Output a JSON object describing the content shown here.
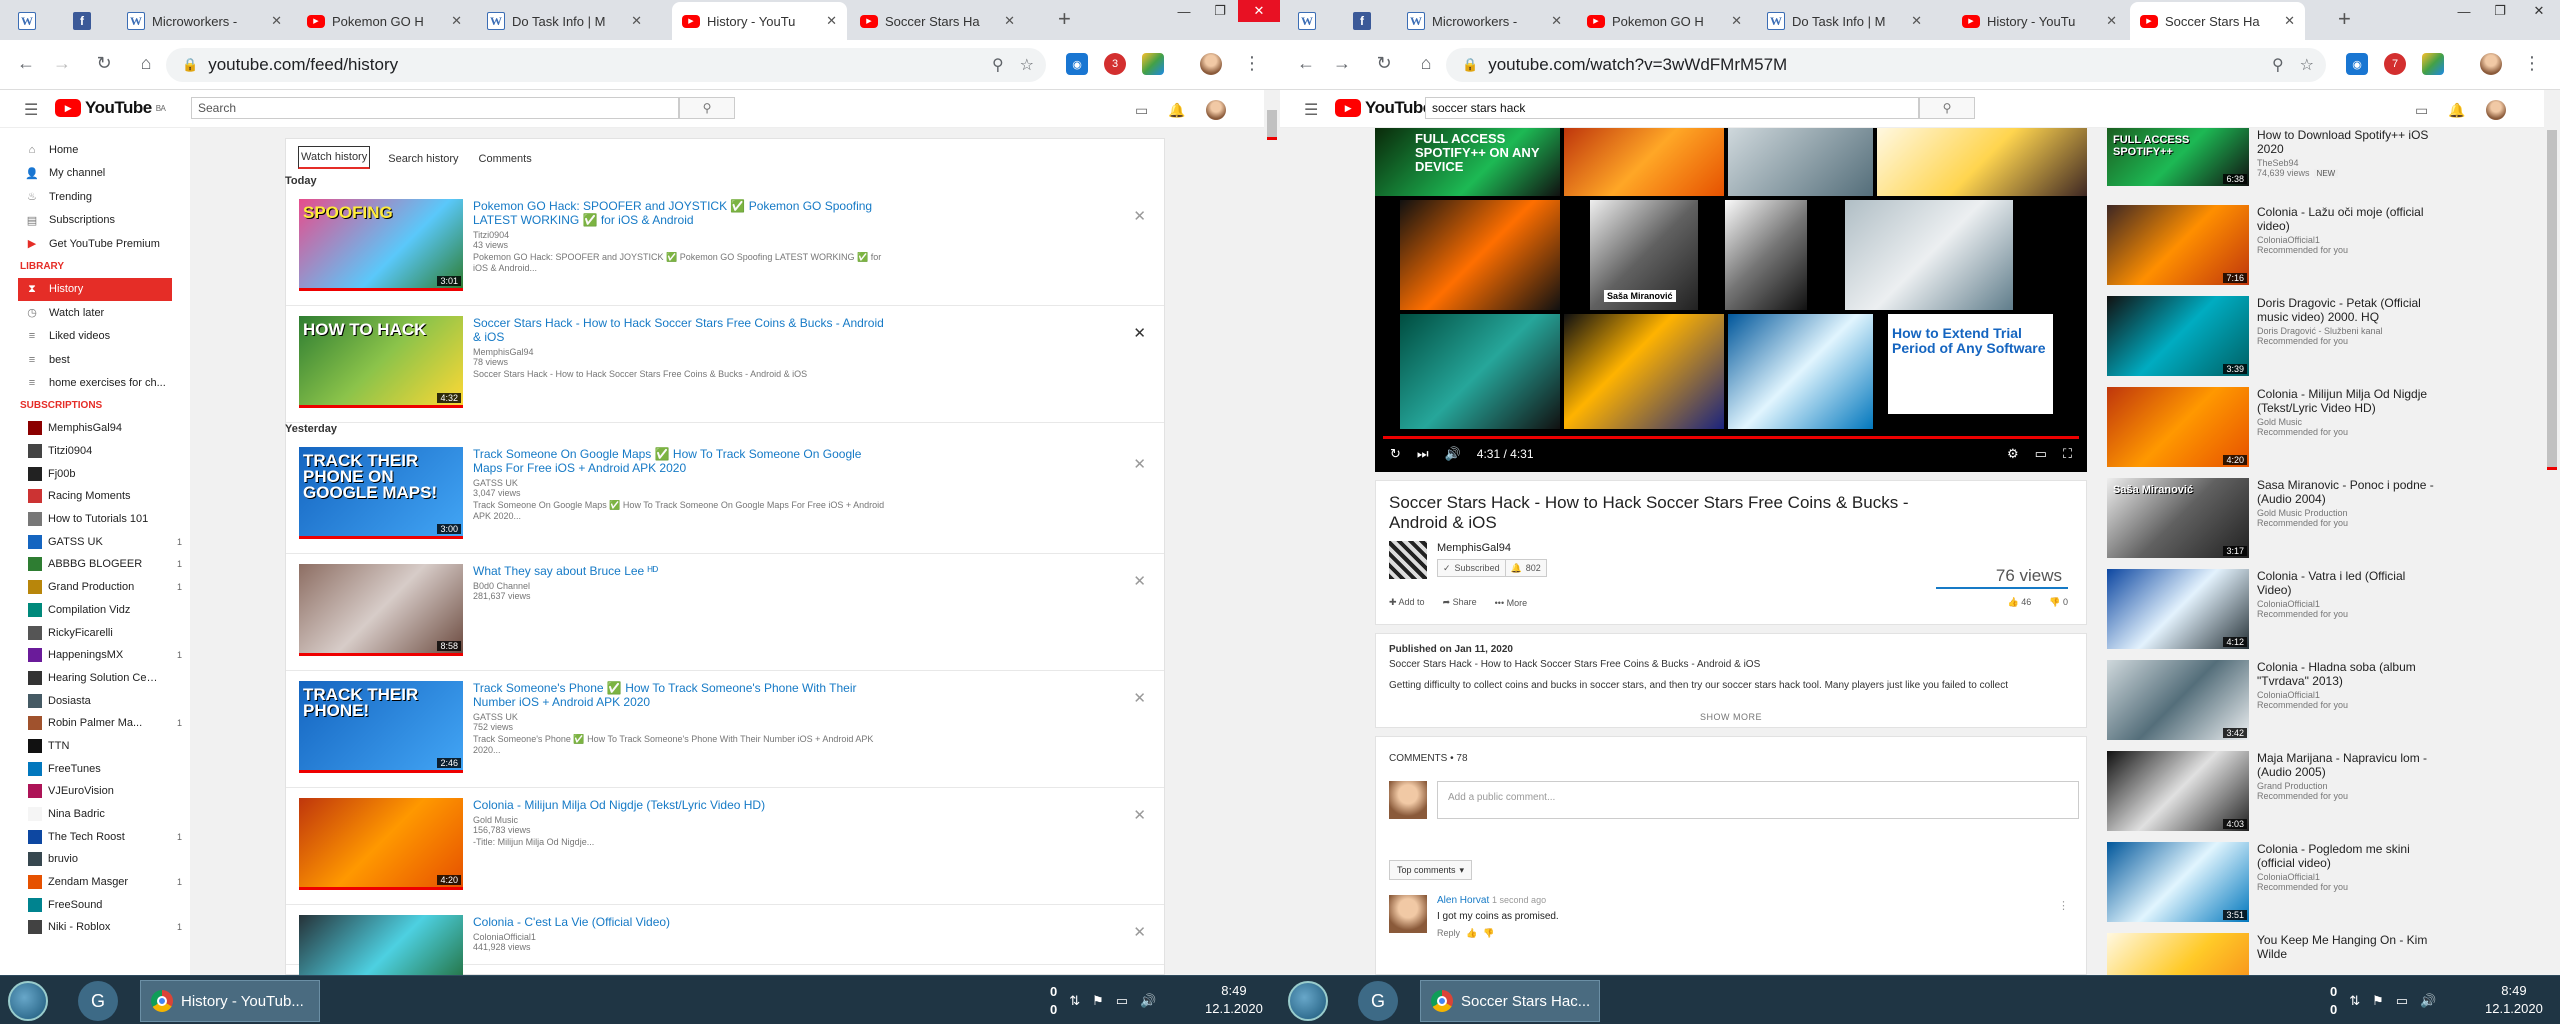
{
  "left": {
    "tabs": [
      {
        "icon": "W",
        "title": ""
      },
      {
        "icon": "f",
        "title": ""
      },
      {
        "icon": "W",
        "title": "Microworkers - "
      },
      {
        "icon": "yt",
        "title": "Pokemon GO H"
      },
      {
        "icon": "W",
        "title": "Do Task Info | M"
      },
      {
        "icon": "yt",
        "title": "History - YouTu"
      },
      {
        "icon": "yt",
        "title": "Soccer Stars Ha"
      }
    ],
    "url": "youtube.com/feed/history",
    "search_placeholder": "Search",
    "ext_badge": "3",
    "guide": {
      "items": [
        "Home",
        "My channel",
        "Trending",
        "Subscriptions",
        "Get YouTube Premium"
      ],
      "library_label": "LIBRARY",
      "library": [
        "History",
        "Watch later",
        "Liked videos",
        "best",
        "home exercises for ch..."
      ],
      "subs_label": "SUBSCRIPTIONS",
      "subs": [
        {
          "name": "MemphisGal94",
          "count": "",
          "color": "#8b0000"
        },
        {
          "name": "Titzi0904",
          "count": "",
          "color": "#444"
        },
        {
          "name": "Fj00b",
          "count": "",
          "color": "#222"
        },
        {
          "name": "Racing Moments",
          "count": "",
          "color": "#c33"
        },
        {
          "name": "How to Tutorials 101",
          "count": "",
          "color": "#777"
        },
        {
          "name": "GATSS UK",
          "count": "1",
          "color": "#1565c0"
        },
        {
          "name": "ABBBG BLOGEER",
          "count": "1",
          "color": "#2e7d32"
        },
        {
          "name": "Grand Production",
          "count": "1",
          "color": "#b8860b"
        },
        {
          "name": "Compilation Vidz",
          "count": "",
          "color": "#00897b"
        },
        {
          "name": "RickyFicarelli",
          "count": "",
          "color": "#555"
        },
        {
          "name": "HappeningsMX",
          "count": "1",
          "color": "#6a1b9a"
        },
        {
          "name": "Hearing Solution Cent...",
          "count": "",
          "color": "#333"
        },
        {
          "name": "Dosiasta",
          "count": "",
          "color": "#455a64"
        },
        {
          "name": "Robin Palmer Ma...",
          "count": "1",
          "color": "#a0522d"
        },
        {
          "name": "TTN",
          "count": "",
          "color": "#111"
        },
        {
          "name": "FreeTunes",
          "count": "",
          "color": "#0277bd"
        },
        {
          "name": "VJEuroVision",
          "count": "",
          "color": "#ad1457"
        },
        {
          "name": "Nina Badric",
          "count": "",
          "color": "#f5f5f5"
        },
        {
          "name": "The Tech Roost",
          "count": "1",
          "color": "#0d47a1"
        },
        {
          "name": "bruvio",
          "count": "",
          "color": "#37474f"
        },
        {
          "name": "Zendam Masger",
          "count": "1",
          "color": "#e65100"
        },
        {
          "name": "FreeSound",
          "count": "",
          "color": "#00838f"
        },
        {
          "name": "Niki - Roblox",
          "count": "1",
          "color": "#424242"
        }
      ]
    },
    "history_tabs": [
      "Watch history",
      "Search history",
      "Comments"
    ],
    "today_label": "Today",
    "yesterday_label": "Yesterday",
    "history": [
      {
        "title": "Pokemon GO Hack: SPOOFER and JOYSTICK ✅ Pokemon GO Spoofing LATEST WORKING ✅ for iOS & Android",
        "channel": "Titzi0904",
        "views": "43 views",
        "desc": "Pokemon GO Hack: SPOOFER and JOYSTICK ✅ Pokemon GO Spoofing LATEST WORKING ✅ for iOS & Android...",
        "dur": "3:01",
        "thumb_text": "SPOOFING",
        "bg": "linear-gradient(135deg,#e74c8b,#5ac8fa 60%,#2e7d32)"
      },
      {
        "title": "Soccer Stars Hack - How to Hack Soccer Stars Free Coins & Bucks - Android & iOS",
        "channel": "MemphisGal94",
        "views": "78 views",
        "desc": "Soccer Stars Hack - How to Hack Soccer Stars Free Coins & Bucks - Android & iOS",
        "dur": "4:32",
        "thumb_text": "HOW TO HACK",
        "bg": "linear-gradient(135deg,#2e7d32,#8bc34a 50%,#fdd835)"
      },
      {
        "title": "Track Someone On Google Maps ✅ How To Track Someone On Google Maps For Free iOS + Android APK 2020",
        "channel": "GATSS UK",
        "views": "3,047 views",
        "desc": "Track Someone On Google Maps ✅ How To Track Someone On Google Maps For Free iOS + Android APK 2020...",
        "dur": "3:00",
        "thumb_text": "TRACK THEIR PHONE ON GOOGLE MAPS!",
        "bg": "linear-gradient(135deg,#1565c0,#42a5f5)"
      },
      {
        "title": "What They say about Bruce Lee ᴴᴰ",
        "channel": "B0d0 Channel",
        "views": "281,637 views",
        "desc": "",
        "dur": "8:58",
        "thumb_text": "",
        "bg": "linear-gradient(135deg,#8d6e63,#d7ccc8 50%,#6d4c41)"
      },
      {
        "title": "Track Someone's Phone ✅ How To Track Someone's Phone With Their Number iOS + Android APK 2020",
        "channel": "GATSS UK",
        "views": "752 views",
        "desc": "Track Someone's Phone ✅ How To Track Someone's Phone With Their Number iOS + Android APK 2020...",
        "dur": "2:46",
        "thumb_text": "TRACK THEIR PHONE!",
        "bg": "linear-gradient(135deg,#1565c0,#42a5f5)"
      },
      {
        "title": "Colonia - Milijun Milja Od Nigdje (Tekst/Lyric Video HD)",
        "channel": "Gold Music",
        "views": "156,783 views",
        "desc": "-Title: Milijun Milja Od Nigdje...",
        "dur": "4:20",
        "thumb_text": "",
        "bg": "linear-gradient(135deg,#bf360c,#ff9800 50%,#e65100)"
      },
      {
        "title": "Colonia - C'est La Vie (Official Video)",
        "channel": "ColoniaOfficial1",
        "views": "441,928 views",
        "desc": "",
        "dur": "",
        "thumb_text": "",
        "bg": "linear-gradient(135deg,#263238,#4dd0e1 50%,#1b5e20)"
      }
    ],
    "taskbar_title": "History - YouTub...",
    "net_top": "0",
    "net_bottom": "0",
    "clock_time": "8:49",
    "clock_date": "12.1.2020"
  },
  "right": {
    "tabs": [
      {
        "icon": "W",
        "title": ""
      },
      {
        "icon": "f",
        "title": ""
      },
      {
        "icon": "W",
        "title": "Microworkers - "
      },
      {
        "icon": "yt",
        "title": "Pokemon GO H"
      },
      {
        "icon": "W",
        "title": "Do Task Info | M"
      },
      {
        "icon": "yt",
        "title": "History - YouTu"
      },
      {
        "icon": "yt",
        "title": "Soccer Stars Ha"
      }
    ],
    "url": "youtube.com/watch?v=3wWdFMrM57M",
    "search_value": "soccer stars hack",
    "ext_badge": "7",
    "player_time": "4:31 / 4:31",
    "collage_texts": [
      "FULL ACCESS SPOTIFY++ ON ANY DEVICE",
      "Saša Miranović",
      "How to Extend Trial Period of Any Software"
    ],
    "video_title": "Soccer Stars Hack - How to Hack Soccer Stars Free Coins & Bucks - Android & iOS",
    "channel": "MemphisGal94",
    "subscribed": "Subscribed",
    "sub_count": "802",
    "views": "76 views",
    "add_to": "Add to",
    "share": "Share",
    "more": "More",
    "likes": "46",
    "dislikes": "0",
    "published": "Published on Jan 11, 2020",
    "desc_line1": "Soccer Stars Hack - How to Hack Soccer Stars Free Coins & Bucks - Android & iOS",
    "desc_line2": "Getting difficulty to collect coins and bucks in soccer stars, and then try our soccer stars hack tool. Many players just like you failed to collect",
    "show_more": "SHOW MORE",
    "comments_count": "COMMENTS • 78",
    "comment_placeholder": "Add a public comment...",
    "top_comments": "Top comments",
    "comment": {
      "author": "Alen Horvat",
      "time": "1 second ago",
      "text": "I got my coins as promised.",
      "reply": "Reply"
    },
    "related": [
      {
        "title": "How to Download Spotify++ iOS 2020",
        "channel": "TheSeb94",
        "meta": "74,639 views",
        "badge": "NEW",
        "dur": "6:38",
        "bg": "linear-gradient(135deg,#1b5e20,#1db954 50%,#111)",
        "text": "FULL ACCESS SPOTIFY++"
      },
      {
        "title": "Colonia - Lažu oči moje (official video)",
        "channel": "ColoniaOfficial1",
        "meta": "Recommended for you",
        "badge": "",
        "dur": "7:16",
        "bg": "linear-gradient(135deg,#3e2723,#ff8f00 50%,#bf360c)",
        "text": ""
      },
      {
        "title": "Doris Dragovic - Petak (Official music video) 2000. HQ",
        "channel": "Doris Dragović - Službeni kanal",
        "meta": "Recommended for you",
        "badge": "",
        "dur": "3:39",
        "bg": "linear-gradient(135deg,#111,#00acc1 50%,#006064)",
        "text": ""
      },
      {
        "title": "Colonia - Milijun Milja Od Nigdje (Tekst/Lyric Video HD)",
        "channel": "Gold Music",
        "meta": "Recommended for you",
        "badge": "",
        "dur": "4:20",
        "bg": "linear-gradient(135deg,#bf360c,#ff9800 50%,#e65100)",
        "text": ""
      },
      {
        "title": "Sasa Miranovic - Ponoc i podne - (Audio 2004)",
        "channel": "Gold Music Production",
        "meta": "Recommended for you",
        "badge": "",
        "dur": "3:17",
        "bg": "linear-gradient(135deg,#eeeeee,#616161 50%,#212121)",
        "text": "Saša Miranović"
      },
      {
        "title": "Colonia - Vatra i led (Official Video)",
        "channel": "ColoniaOfficial1",
        "meta": "Recommended for you",
        "badge": "",
        "dur": "4:12",
        "bg": "linear-gradient(135deg,#0d47a1,#e3f2fd 50%,#263238)",
        "text": ""
      },
      {
        "title": "Colonia - Hladna soba (album \"Tvrdava\" 2013)",
        "channel": "ColoniaOfficial1",
        "meta": "Recommended for you",
        "badge": "",
        "dur": "3:42",
        "bg": "linear-gradient(135deg,#cfd8dc,#546e7a 50%,#eceff1)",
        "text": ""
      },
      {
        "title": "Maja Marijana - Napravicu lom - (Audio 2005)",
        "channel": "Grand Production",
        "meta": "Recommended for you",
        "badge": "",
        "dur": "4:03",
        "bg": "linear-gradient(135deg,#111,#e0e0e0 50%,#212121)",
        "text": ""
      },
      {
        "title": "Colonia - Pogledom me skini (official video)",
        "channel": "ColoniaOfficial1",
        "meta": "Recommended for you",
        "badge": "",
        "dur": "3:51",
        "bg": "linear-gradient(135deg,#01579b,#e1f5fe 50%,#0277bd)",
        "text": ""
      },
      {
        "title": "You Keep Me Hanging On - Kim Wilde",
        "channel": "",
        "meta": "",
        "badge": "",
        "dur": "",
        "bg": "linear-gradient(135deg,#fff8e1,#ffca28 50%,#f57f17)",
        "text": ""
      }
    ],
    "taskbar_title": "Soccer Stars Hac...",
    "net_top": "0",
    "net_bottom": "0",
    "clock_time": "8:49",
    "clock_date": "12.1.2020"
  },
  "colors": {
    "accent": "#e52d27",
    "link": "#167ac6",
    "taskbar": "#1f3544"
  }
}
